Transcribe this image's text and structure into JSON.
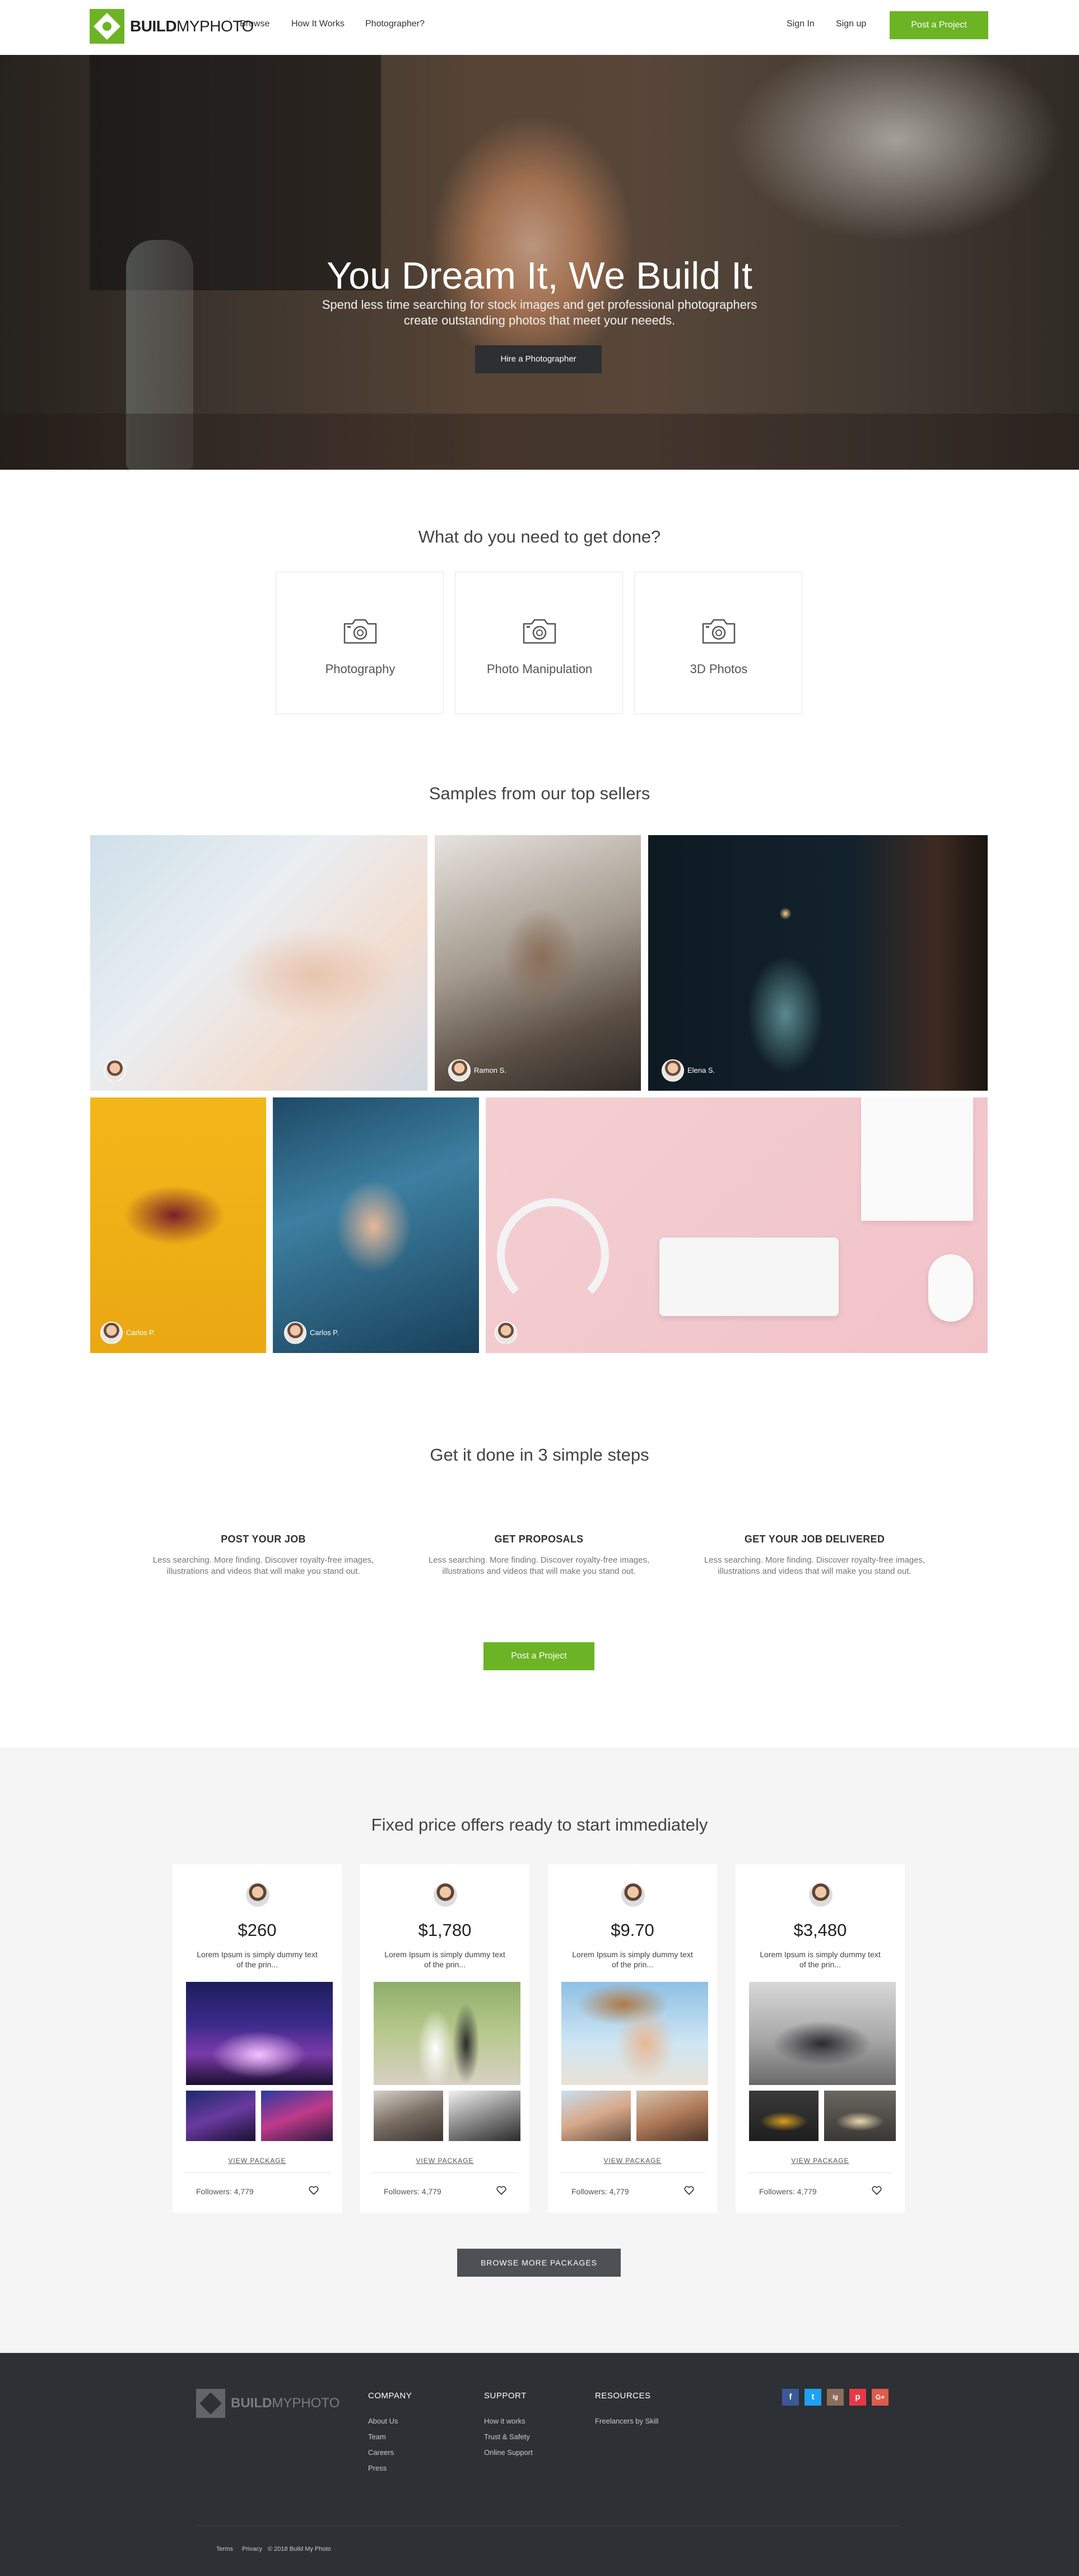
{
  "nav": {
    "logo_bold": "BUILD",
    "logo_light": "MYPHOTO",
    "links": [
      "Browse",
      "How It Works",
      "Photographer?"
    ],
    "sign_in": "Sign In",
    "sign_up": "Sign up",
    "post_project": "Post a Project"
  },
  "hero": {
    "title": "You Dream It, We Build It",
    "subtitle": "Spend less time searching for stock images and get professional photographers create outstanding photos that meet your neeeds.",
    "cta": "Hire a Photographer"
  },
  "services": {
    "title": "What do you need to get done?",
    "items": [
      "Photography",
      "Photo Manipulation",
      "3D Photos"
    ]
  },
  "samples": {
    "title": "Samples from our top sellers",
    "sellers": [
      "",
      "Ramon S.",
      "Elena S.",
      "Carlos P.",
      "Carlos P.",
      ""
    ]
  },
  "steps": {
    "title": "Get it done in 3 simple steps",
    "items": [
      {
        "title": "POST YOUR JOB",
        "desc": "Less searching. More finding. Discover royalty-free images, illustrations and videos that will make you stand out."
      },
      {
        "title": "GET PROPOSALS",
        "desc": "Less searching. More finding. Discover royalty-free images, illustrations and videos that will make you stand out."
      },
      {
        "title": "GET YOUR JOB DELIVERED",
        "desc": "Less searching. More finding. Discover royalty-free images, illustrations and videos that will make you stand out."
      }
    ],
    "cta": "Post a Project"
  },
  "packages": {
    "title": "Fixed price offers ready to start immediately",
    "items": [
      {
        "price": "$260",
        "desc": "Lorem Ipsum is simply dummy text of the prin...",
        "view": "VIEW PACKAGE",
        "followers": "Followers: 4,779"
      },
      {
        "price": "$1,780",
        "desc": "Lorem Ipsum is simply dummy text of the prin...",
        "view": "VIEW PACKAGE",
        "followers": "Followers: 4,779"
      },
      {
        "price": "$9.70",
        "desc": "Lorem Ipsum is simply dummy text of the prin...",
        "view": "VIEW PACKAGE",
        "followers": "Followers: 4,779"
      },
      {
        "price": "$3,480",
        "desc": "Lorem Ipsum is simply dummy text of the prin...",
        "view": "VIEW PACKAGE",
        "followers": "Followers: 4,779"
      }
    ],
    "browse": "BROWSE MORE PACKAGES"
  },
  "footer": {
    "logo_bold": "BUILD",
    "logo_light": "MYPHOTO",
    "company": {
      "title": "COMPANY",
      "links": [
        "About Us",
        "Team",
        "Careers",
        "Press"
      ]
    },
    "support": {
      "title": "SUPPORT",
      "links": [
        "How it works",
        "Trust & Safety",
        "Online Support"
      ]
    },
    "resources": {
      "title": "RESOURCES",
      "links": [
        "Freelancers by Skill"
      ]
    },
    "social": [
      "f",
      "t",
      "ig",
      "p",
      "G+"
    ],
    "bottom": [
      "Terms",
      "Privacy",
      "© 2018 Build My Photo"
    ]
  },
  "colors": {
    "accent": "#6cb425",
    "dark_button": "#2d2f33",
    "footer_bg": "#2d3034",
    "packages_bg": "#f5f5f5",
    "facebook": "#3b5998",
    "twitter": "#1da1f2",
    "instagram": "#8a6d5a",
    "pinterest": "#e63946",
    "google": "#e05b4b"
  },
  "icons": {
    "service": "camera-icon",
    "package_action": "heart-icon"
  }
}
